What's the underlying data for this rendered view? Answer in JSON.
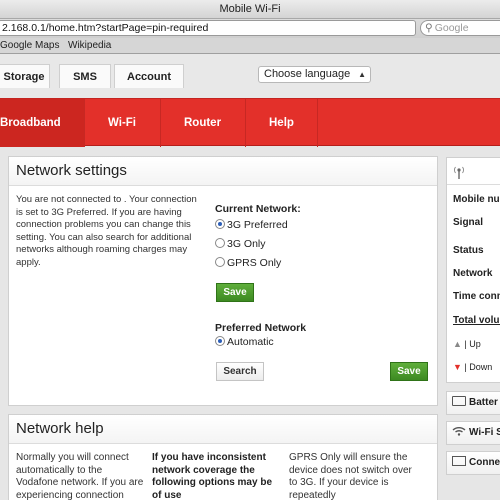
{
  "browser": {
    "window_title": "Mobile Wi-Fi",
    "url": "2.168.0.1/home.htm?startPage=pin-required",
    "search_placeholder": "Google",
    "bookmarks": [
      "Google Maps",
      "Wikipedia"
    ]
  },
  "top_tabs": [
    "Storage",
    "SMS",
    "Account"
  ],
  "language_select": {
    "value": "Choose language"
  },
  "nav": {
    "items": [
      "Broadband",
      "Wi-Fi",
      "Router",
      "Help"
    ],
    "active": "Broadband",
    "accent": "#e3302a"
  },
  "network_settings": {
    "title": "Network settings",
    "description": "You are not connected to . Your connection is set to 3G Preferred. If you are having connection problems you can change this setting. You can also search for additional networks although roaming charges may apply.",
    "current_network_label": "Current Network:",
    "current_options": [
      {
        "label": "3G Preferred",
        "selected": true
      },
      {
        "label": "3G Only",
        "selected": false
      },
      {
        "label": "GPRS Only",
        "selected": false
      }
    ],
    "save_label": "Save",
    "preferred_label": "Preferred Network",
    "preferred_options": [
      {
        "label": "Automatic",
        "selected": true
      }
    ],
    "search_label": "Search",
    "save2_label": "Save"
  },
  "network_help": {
    "title": "Network help",
    "col1": "Normally you will connect automatically to the Vodafone network. If you are experiencing connection",
    "col2": "If you have inconsistent network coverage the following options may be of use",
    "col3": "GPRS Only will ensure the device does not switch over to 3G. If your device is repeatedly"
  },
  "sidebar": {
    "rows": [
      "Mobile nu",
      "Signal",
      "Status",
      "Network",
      "Time conn",
      "Total volun",
      "Up",
      "Down"
    ],
    "boxes": [
      "Batter",
      "Wi-Fi S",
      "Conne"
    ]
  }
}
